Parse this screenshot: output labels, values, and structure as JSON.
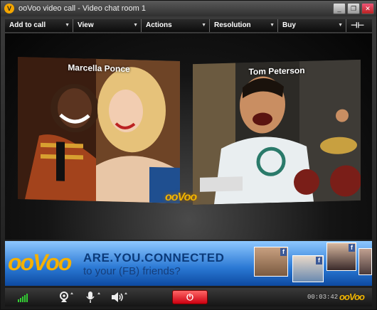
{
  "window": {
    "title": "ooVoo video call - Video chat room 1",
    "app_icon": "V"
  },
  "menu": [
    {
      "label": "Add to call"
    },
    {
      "label": "View"
    },
    {
      "label": "Actions"
    },
    {
      "label": "Resolution"
    },
    {
      "label": "Buy"
    }
  ],
  "participants": [
    {
      "name": "Marcella Ponce"
    },
    {
      "name": "Tom Peterson"
    }
  ],
  "stage_logo": "ooVoo",
  "ad": {
    "logo": "ooVoo",
    "headline": "ARE.YOU.CONNECTED",
    "subline": "to your (FB) friends?",
    "fb_badge": "f"
  },
  "bottom": {
    "timer": "00:03:42",
    "logo": "ooVoo"
  },
  "colors": {
    "accent": "#f0b400",
    "hangup": "#dd1111",
    "ad_blue": "#2a78d4",
    "facebook": "#3b5998"
  },
  "icons": [
    "minimize-icon",
    "restore-icon",
    "close-icon",
    "pin-icon",
    "signal-icon",
    "webcam-icon",
    "microphone-icon",
    "speaker-icon",
    "power-icon"
  ]
}
